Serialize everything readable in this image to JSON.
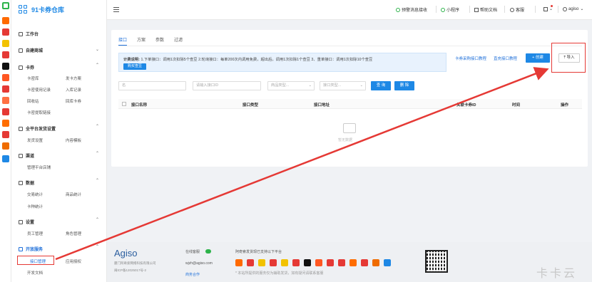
{
  "app": {
    "title": "91卡券仓库"
  },
  "topbar": {
    "items": [
      "预警消息接收",
      "小程序",
      "帮助文档",
      "客服"
    ],
    "user": "agiso"
  },
  "sidebar": {
    "workbench": "工作台",
    "self_mall": "自建商城",
    "card": {
      "title": "卡券",
      "items": [
        "卡密库",
        "发卡方案",
        "卡密使用记录",
        "入库记录",
        "回收站",
        "回库卡券",
        "卡密提取链接"
      ]
    },
    "all_platform": {
      "title": "全平台发货设置",
      "items": [
        "发货设置",
        "内容模板"
      ]
    },
    "channel": {
      "title": "渠道",
      "items": [
        "管理平台店铺"
      ]
    },
    "data": {
      "title": "数据",
      "items": [
        "交易统计",
        "商品统计",
        "卡种统计"
      ]
    },
    "settings": {
      "title": "设置",
      "items": [
        "员工管理",
        "角色管理"
      ]
    },
    "open": {
      "title": "开放服务",
      "items": [
        "接口管理",
        "应用授权",
        "开发文档"
      ]
    }
  },
  "main": {
    "tabs": [
      "接口",
      "方案",
      "参数",
      "过滤"
    ],
    "notice": {
      "label": "计费说明:",
      "text": "1.下单接口：调用1次扣除5个查豆 2.轮询接口：每单200次内调用免费，超出后，调用1次扣除1个查豆  3、重单接口：调用1次扣除10个查豆",
      "button": "购买查豆"
    },
    "link_1": "卡券采购接口教程",
    "link_2": "直充接口教程",
    "create_button": "+ 创建",
    "import_button": "导入",
    "filters": {
      "f1": "名",
      "f2": "请输入接口ID",
      "f3": "商品类型...",
      "f4": "接口类型...",
      "query": "查 询",
      "delete": "删 除"
    },
    "columns": [
      "接口名称",
      "接口类型",
      "接口地址",
      "关联卡券ID",
      "时间",
      "操作"
    ],
    "empty": "暂无数据"
  },
  "footer": {
    "logo": "Agiso",
    "copyright": "厦门阿奇索网络科技有限公司",
    "icp": "闽ICP备12025017号-2",
    "online_service": "在线客服",
    "email": "wjzh@agiso.com",
    "business": "商务合作",
    "platforms_title": "阿奇索发货现已支持以下平台",
    "platforms_note": "* 本站所提供的服务仅为辅助发货，如有疑问请联系客服"
  },
  "watermark": "卡卡云",
  "colors": {
    "accent": "#1e88e5",
    "highlight": "#e53935",
    "brand_green": "#2db34a"
  }
}
